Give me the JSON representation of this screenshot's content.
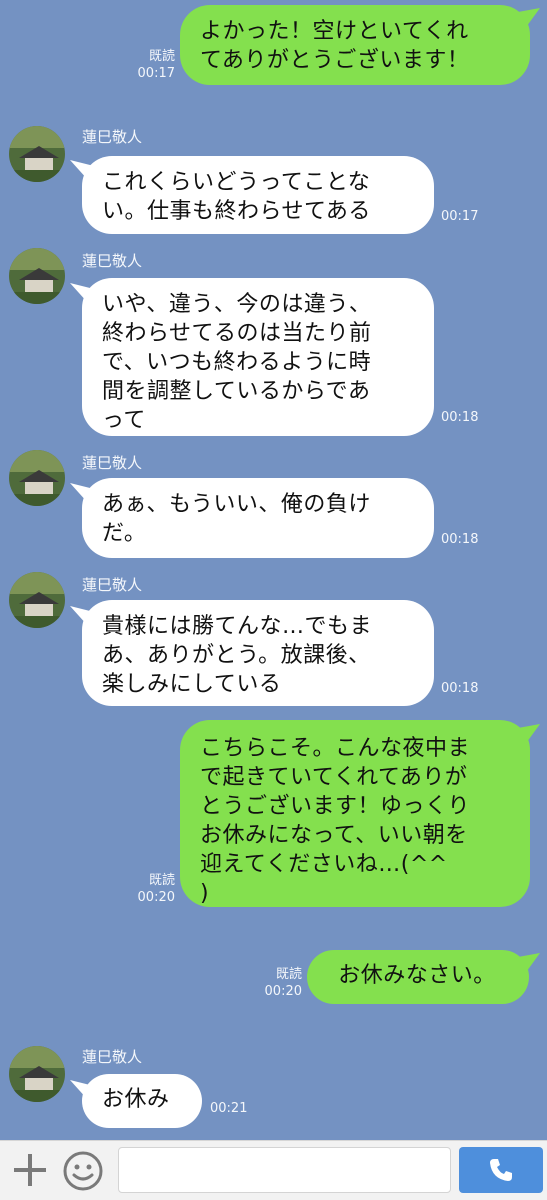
{
  "messages": [
    {
      "dir": "out",
      "text": "よかった！空けといてくれ\nてありがとうございます！",
      "read": "既読",
      "time": "00:17"
    },
    {
      "dir": "in",
      "sender": "蓮巳敬人",
      "text": "これくらいどうってことな\nい。仕事も終わらせてある",
      "time": "00:17"
    },
    {
      "dir": "in",
      "sender": "蓮巳敬人",
      "text": "いや、違う、今のは違う、\n終わらせてるのは当たり前\nで、いつも終わるように時\n間を調整しているからであ\nって",
      "time": "00:18"
    },
    {
      "dir": "in",
      "sender": "蓮巳敬人",
      "text": "あぁ、もういい、俺の負け\nだ。",
      "time": "00:18"
    },
    {
      "dir": "in",
      "sender": "蓮巳敬人",
      "text": "貴様には勝てんな…でもま\nあ、ありがとう。放課後、\n楽しみにしている",
      "time": "00:18"
    },
    {
      "dir": "out",
      "text": "こちらこそ。こんな夜中ま\nで起きていてくれてありが\nとうございます！ゆっくり\nお休みになって、いい朝を\n迎えてくださいね…(^^\n)",
      "read": "既読",
      "time": "00:20"
    },
    {
      "dir": "out",
      "text": "お休みなさい。",
      "read": "既読",
      "time": "00:20"
    },
    {
      "dir": "in",
      "sender": "蓮巳敬人",
      "text": "お休み",
      "time": "00:21"
    }
  ],
  "input": {
    "value": "",
    "placeholder": ""
  },
  "icons": {
    "add": "plus-icon",
    "sticker": "smile-icon",
    "call": "phone-icon"
  },
  "colors": {
    "background": "#7492c2",
    "outgoing": "#84e04e",
    "incoming": "#ffffff",
    "call_button": "#4e8fdc"
  }
}
